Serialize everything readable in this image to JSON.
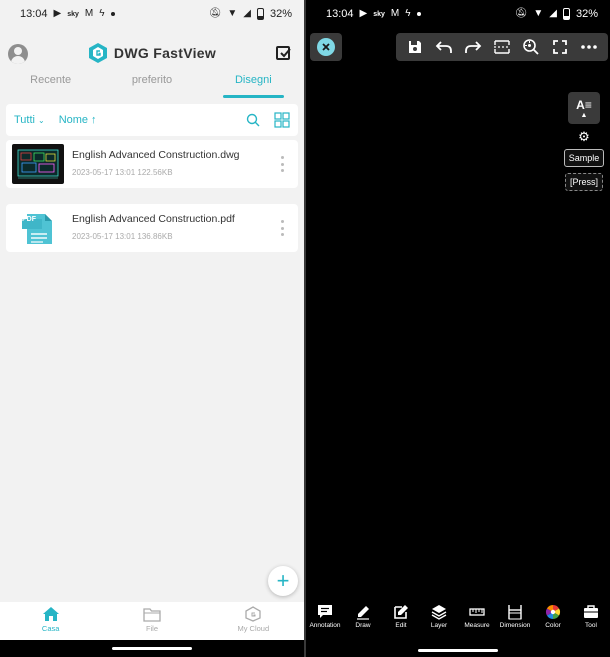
{
  "status_left": {
    "time": "13:04",
    "battery": "32%"
  },
  "status_right": {
    "time": "13:04",
    "battery": "32%"
  },
  "app": {
    "name": "DWG FastView",
    "brand_color": "#26b5c5"
  },
  "tabs": [
    {
      "label": "Recente",
      "active": false
    },
    {
      "label": "preferito",
      "active": false
    },
    {
      "label": "Disegni",
      "active": true
    }
  ],
  "filters": {
    "scope_label": "Tutti",
    "sort_label": "Nome"
  },
  "files": [
    {
      "name": "English Advanced Construction.dwg",
      "date": "2023-05-17 13:01",
      "size": "122.56KB",
      "thumb": "dwg-thumbnail"
    },
    {
      "name": "English Advanced Construction.pdf",
      "date": "2023-05-17 13:01",
      "size": "136.86KB",
      "thumb": "pdf-icon",
      "thumb_label": "PDF"
    }
  ],
  "bottom_nav": [
    {
      "label": "Casa",
      "active": true,
      "icon": "home-icon"
    },
    {
      "label": "File",
      "active": false,
      "icon": "folder-icon"
    },
    {
      "label": "My Cloud",
      "active": false,
      "icon": "cloud-icon"
    }
  ],
  "viewer": {
    "text_style_label": "A",
    "sample_label": "Sample",
    "press_label": "[Press]",
    "bottom_tools": [
      {
        "label": "Annotation",
        "icon": "comment-icon"
      },
      {
        "label": "Draw",
        "icon": "pencil-icon"
      },
      {
        "label": "Edit",
        "icon": "edit-icon"
      },
      {
        "label": "Layer",
        "icon": "layers-icon"
      },
      {
        "label": "Measure",
        "icon": "ruler-icon"
      },
      {
        "label": "Dimension",
        "icon": "dimension-icon"
      },
      {
        "label": "Color",
        "icon": "color-wheel-icon"
      },
      {
        "label": "Tool",
        "icon": "toolbox-icon"
      }
    ]
  }
}
